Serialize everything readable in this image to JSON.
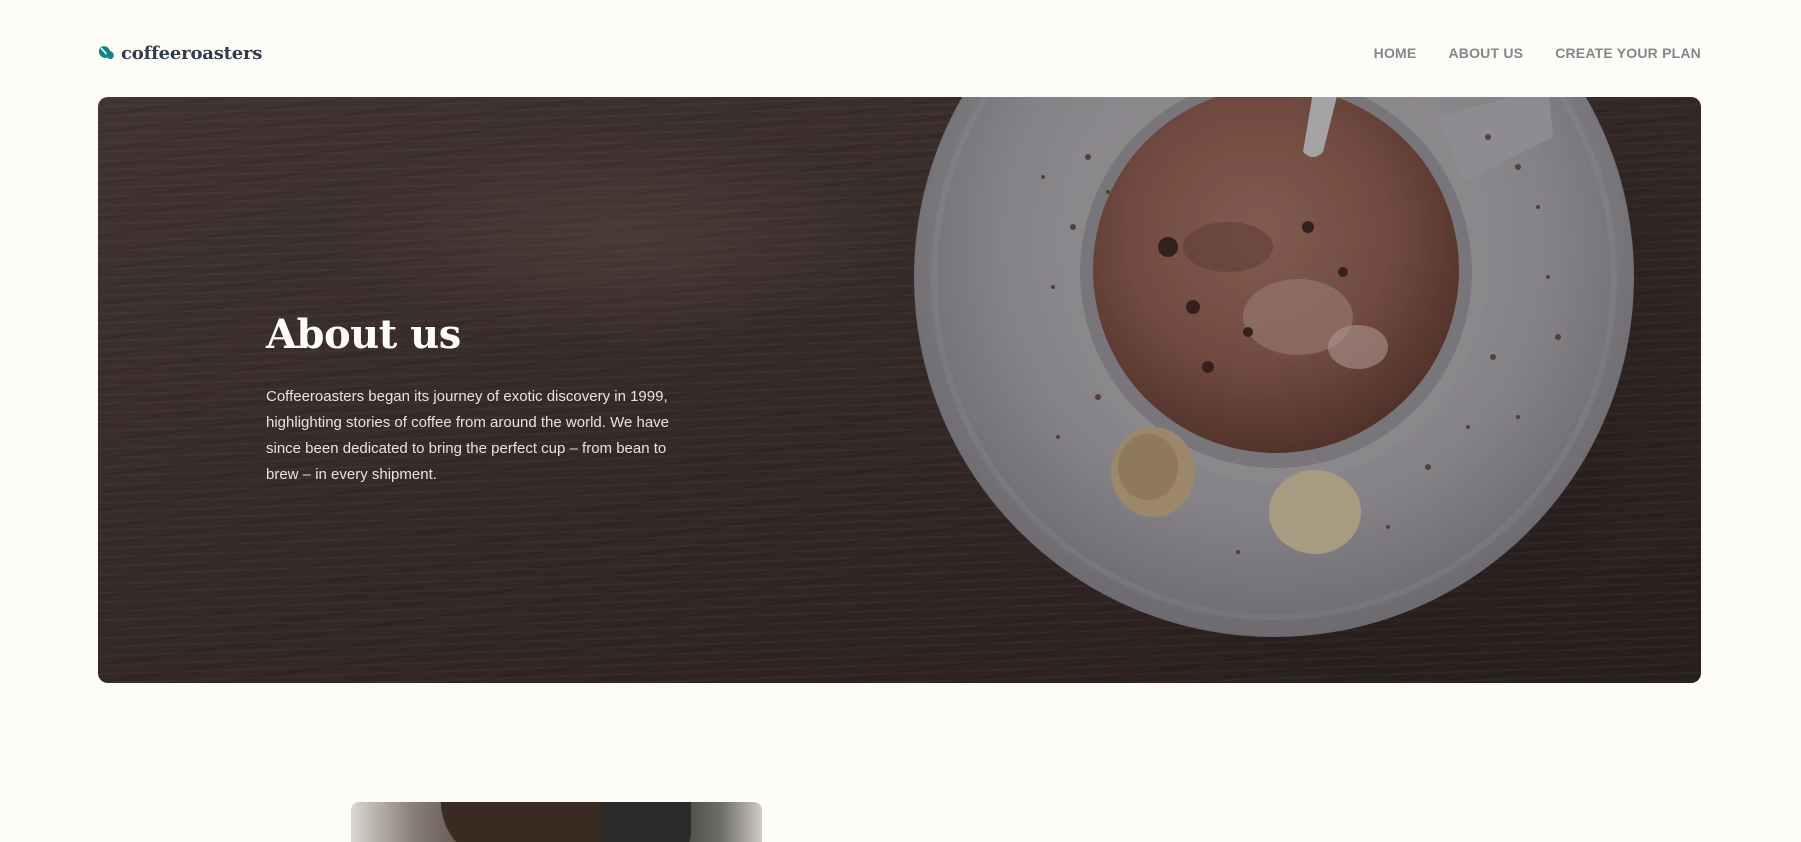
{
  "header": {
    "logo_text": "coffeeroasters",
    "logo_icon": "coffee-bean-icon",
    "nav": [
      {
        "label": "HOME"
      },
      {
        "label": "ABOUT US"
      },
      {
        "label": "CREATE YOUR PLAN"
      }
    ]
  },
  "hero": {
    "title": "About us",
    "text": "Coffeeroasters began its journey of exotic discovery in 1999, highlighting stories of coffee from around the world. We have since been dedicated to bring the perfect cup – from bean to brew – in every shipment."
  },
  "colors": {
    "background": "#fdfcf7",
    "logo_text": "#333d4b",
    "accent": "#0e8784",
    "nav_text": "#83888f"
  }
}
